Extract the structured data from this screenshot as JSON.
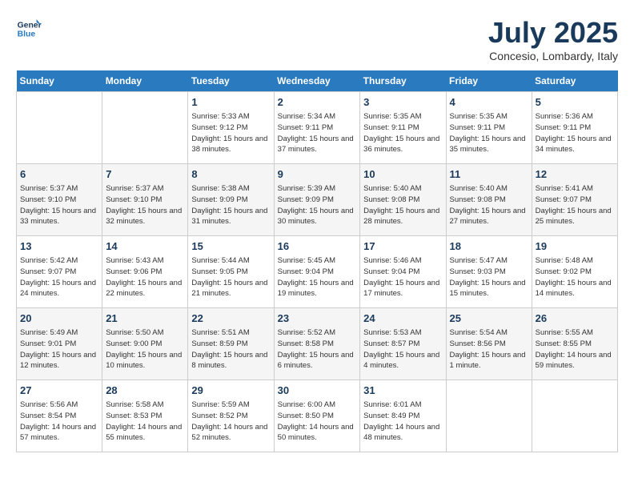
{
  "header": {
    "logo_line1": "General",
    "logo_line2": "Blue",
    "month": "July 2025",
    "location": "Concesio, Lombardy, Italy"
  },
  "weekdays": [
    "Sunday",
    "Monday",
    "Tuesday",
    "Wednesday",
    "Thursday",
    "Friday",
    "Saturday"
  ],
  "weeks": [
    [
      {
        "day": "",
        "sunrise": "",
        "sunset": "",
        "daylight": ""
      },
      {
        "day": "",
        "sunrise": "",
        "sunset": "",
        "daylight": ""
      },
      {
        "day": "1",
        "sunrise": "Sunrise: 5:33 AM",
        "sunset": "Sunset: 9:12 PM",
        "daylight": "Daylight: 15 hours and 38 minutes."
      },
      {
        "day": "2",
        "sunrise": "Sunrise: 5:34 AM",
        "sunset": "Sunset: 9:11 PM",
        "daylight": "Daylight: 15 hours and 37 minutes."
      },
      {
        "day": "3",
        "sunrise": "Sunrise: 5:35 AM",
        "sunset": "Sunset: 9:11 PM",
        "daylight": "Daylight: 15 hours and 36 minutes."
      },
      {
        "day": "4",
        "sunrise": "Sunrise: 5:35 AM",
        "sunset": "Sunset: 9:11 PM",
        "daylight": "Daylight: 15 hours and 35 minutes."
      },
      {
        "day": "5",
        "sunrise": "Sunrise: 5:36 AM",
        "sunset": "Sunset: 9:11 PM",
        "daylight": "Daylight: 15 hours and 34 minutes."
      }
    ],
    [
      {
        "day": "6",
        "sunrise": "Sunrise: 5:37 AM",
        "sunset": "Sunset: 9:10 PM",
        "daylight": "Daylight: 15 hours and 33 minutes."
      },
      {
        "day": "7",
        "sunrise": "Sunrise: 5:37 AM",
        "sunset": "Sunset: 9:10 PM",
        "daylight": "Daylight: 15 hours and 32 minutes."
      },
      {
        "day": "8",
        "sunrise": "Sunrise: 5:38 AM",
        "sunset": "Sunset: 9:09 PM",
        "daylight": "Daylight: 15 hours and 31 minutes."
      },
      {
        "day": "9",
        "sunrise": "Sunrise: 5:39 AM",
        "sunset": "Sunset: 9:09 PM",
        "daylight": "Daylight: 15 hours and 30 minutes."
      },
      {
        "day": "10",
        "sunrise": "Sunrise: 5:40 AM",
        "sunset": "Sunset: 9:08 PM",
        "daylight": "Daylight: 15 hours and 28 minutes."
      },
      {
        "day": "11",
        "sunrise": "Sunrise: 5:40 AM",
        "sunset": "Sunset: 9:08 PM",
        "daylight": "Daylight: 15 hours and 27 minutes."
      },
      {
        "day": "12",
        "sunrise": "Sunrise: 5:41 AM",
        "sunset": "Sunset: 9:07 PM",
        "daylight": "Daylight: 15 hours and 25 minutes."
      }
    ],
    [
      {
        "day": "13",
        "sunrise": "Sunrise: 5:42 AM",
        "sunset": "Sunset: 9:07 PM",
        "daylight": "Daylight: 15 hours and 24 minutes."
      },
      {
        "day": "14",
        "sunrise": "Sunrise: 5:43 AM",
        "sunset": "Sunset: 9:06 PM",
        "daylight": "Daylight: 15 hours and 22 minutes."
      },
      {
        "day": "15",
        "sunrise": "Sunrise: 5:44 AM",
        "sunset": "Sunset: 9:05 PM",
        "daylight": "Daylight: 15 hours and 21 minutes."
      },
      {
        "day": "16",
        "sunrise": "Sunrise: 5:45 AM",
        "sunset": "Sunset: 9:04 PM",
        "daylight": "Daylight: 15 hours and 19 minutes."
      },
      {
        "day": "17",
        "sunrise": "Sunrise: 5:46 AM",
        "sunset": "Sunset: 9:04 PM",
        "daylight": "Daylight: 15 hours and 17 minutes."
      },
      {
        "day": "18",
        "sunrise": "Sunrise: 5:47 AM",
        "sunset": "Sunset: 9:03 PM",
        "daylight": "Daylight: 15 hours and 15 minutes."
      },
      {
        "day": "19",
        "sunrise": "Sunrise: 5:48 AM",
        "sunset": "Sunset: 9:02 PM",
        "daylight": "Daylight: 15 hours and 14 minutes."
      }
    ],
    [
      {
        "day": "20",
        "sunrise": "Sunrise: 5:49 AM",
        "sunset": "Sunset: 9:01 PM",
        "daylight": "Daylight: 15 hours and 12 minutes."
      },
      {
        "day": "21",
        "sunrise": "Sunrise: 5:50 AM",
        "sunset": "Sunset: 9:00 PM",
        "daylight": "Daylight: 15 hours and 10 minutes."
      },
      {
        "day": "22",
        "sunrise": "Sunrise: 5:51 AM",
        "sunset": "Sunset: 8:59 PM",
        "daylight": "Daylight: 15 hours and 8 minutes."
      },
      {
        "day": "23",
        "sunrise": "Sunrise: 5:52 AM",
        "sunset": "Sunset: 8:58 PM",
        "daylight": "Daylight: 15 hours and 6 minutes."
      },
      {
        "day": "24",
        "sunrise": "Sunrise: 5:53 AM",
        "sunset": "Sunset: 8:57 PM",
        "daylight": "Daylight: 15 hours and 4 minutes."
      },
      {
        "day": "25",
        "sunrise": "Sunrise: 5:54 AM",
        "sunset": "Sunset: 8:56 PM",
        "daylight": "Daylight: 15 hours and 1 minute."
      },
      {
        "day": "26",
        "sunrise": "Sunrise: 5:55 AM",
        "sunset": "Sunset: 8:55 PM",
        "daylight": "Daylight: 14 hours and 59 minutes."
      }
    ],
    [
      {
        "day": "27",
        "sunrise": "Sunrise: 5:56 AM",
        "sunset": "Sunset: 8:54 PM",
        "daylight": "Daylight: 14 hours and 57 minutes."
      },
      {
        "day": "28",
        "sunrise": "Sunrise: 5:58 AM",
        "sunset": "Sunset: 8:53 PM",
        "daylight": "Daylight: 14 hours and 55 minutes."
      },
      {
        "day": "29",
        "sunrise": "Sunrise: 5:59 AM",
        "sunset": "Sunset: 8:52 PM",
        "daylight": "Daylight: 14 hours and 52 minutes."
      },
      {
        "day": "30",
        "sunrise": "Sunrise: 6:00 AM",
        "sunset": "Sunset: 8:50 PM",
        "daylight": "Daylight: 14 hours and 50 minutes."
      },
      {
        "day": "31",
        "sunrise": "Sunrise: 6:01 AM",
        "sunset": "Sunset: 8:49 PM",
        "daylight": "Daylight: 14 hours and 48 minutes."
      },
      {
        "day": "",
        "sunrise": "",
        "sunset": "",
        "daylight": ""
      },
      {
        "day": "",
        "sunrise": "",
        "sunset": "",
        "daylight": ""
      }
    ]
  ]
}
